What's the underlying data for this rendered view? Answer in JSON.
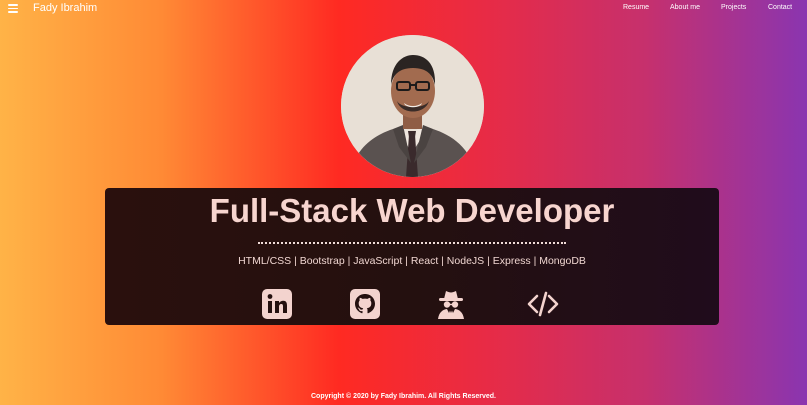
{
  "header": {
    "menu_icon": "hamburger-menu-icon",
    "brand": "Fady Ibrahim",
    "nav": [
      {
        "label": "Resume"
      },
      {
        "label": "About me"
      },
      {
        "label": "Projects"
      },
      {
        "label": "Contact"
      }
    ]
  },
  "hero": {
    "photo": "profile-photo-avatar",
    "title": "Full-Stack Web Developer",
    "skills": "HTML/CSS | Bootstrap | JavaScript | React | NodeJS | Express | MongoDB",
    "social_icons": [
      "linkedin-icon",
      "github-icon",
      "spy-incognito-icon",
      "code-icon"
    ]
  },
  "footer": {
    "copyright": "Copyright © 2020 by Fady Ibrahim. All Rights Reserved."
  },
  "colors": {
    "gradient": [
      "#ffb347",
      "#ff2a22",
      "#8a35b0"
    ],
    "card_bg": "#24100f",
    "title_color": "#f7d5cf"
  }
}
